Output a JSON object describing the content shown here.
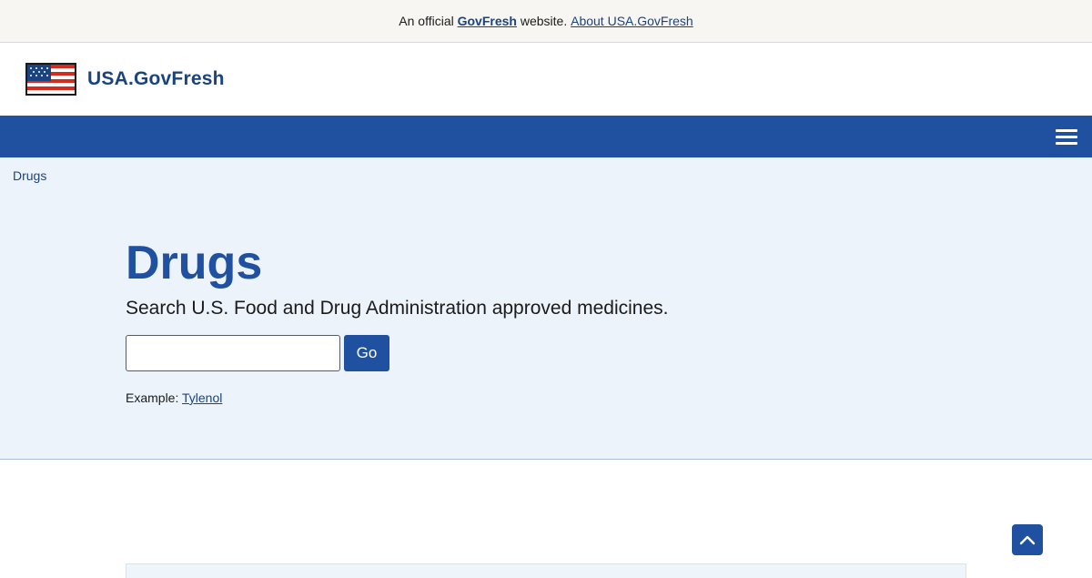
{
  "banner": {
    "prefix": "An official",
    "brand": "GovFresh",
    "suffix": "website.",
    "about_link": "About USA.GovFresh"
  },
  "header": {
    "site_title": "USA.GovFresh",
    "flag_icon": "us-flag-icon"
  },
  "nav": {
    "menu_icon": "hamburger-menu-icon"
  },
  "breadcrumb": {
    "current": "Drugs"
  },
  "hero": {
    "title": "Drugs",
    "subtitle": "Search U.S. Food and Drug Administration approved medicines.",
    "search": {
      "value": "",
      "button_label": "Go"
    },
    "example": {
      "label": "Example:",
      "link": "Tylenol"
    }
  },
  "back_to_top": {
    "icon": "chevron-up-icon"
  },
  "colors": {
    "primary": "#1f51a0",
    "link": "#1a4480",
    "hero_bg": "#ecf3fa",
    "banner_bg": "#f7f6f3"
  }
}
